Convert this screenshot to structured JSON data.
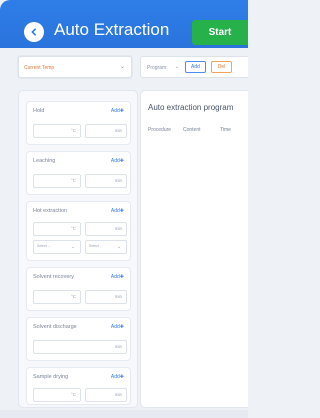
{
  "header": {
    "title": "Auto Extraction",
    "start_label": "Start",
    "back_icon": "chevron-left-icon"
  },
  "filter": {
    "placeholder": "Current Temp"
  },
  "program_bar": {
    "label": "Program:",
    "add_label": "Add",
    "del_label": "Del"
  },
  "steps": [
    {
      "name": "Hold",
      "add": "Add✚",
      "fields": [
        "°C",
        "min"
      ]
    },
    {
      "name": "Leaching",
      "add": "Add✚",
      "fields": [
        "°C",
        "min"
      ]
    },
    {
      "name": "Hot extraction",
      "add": "Add✚",
      "fields": [
        "°C",
        "min"
      ],
      "extra": [
        "Select ...",
        "Select ..."
      ]
    },
    {
      "name": "Solvent recovery",
      "add": "Add✚",
      "fields": [
        "°C",
        "min"
      ]
    },
    {
      "name": "Solvent discharge",
      "add": "Add✚",
      "fields": [
        "min"
      ]
    },
    {
      "name": "Sample drying",
      "add": "Add✚",
      "fields": [
        "°C",
        "min"
      ]
    }
  ],
  "program_panel": {
    "title": "Auto extraction program",
    "columns": [
      "Procedure",
      "Content",
      "Time"
    ]
  },
  "colors": {
    "header_blue": "#2f7ee8",
    "start_green": "#27b14b",
    "accent_orange": "#e07a3c"
  }
}
